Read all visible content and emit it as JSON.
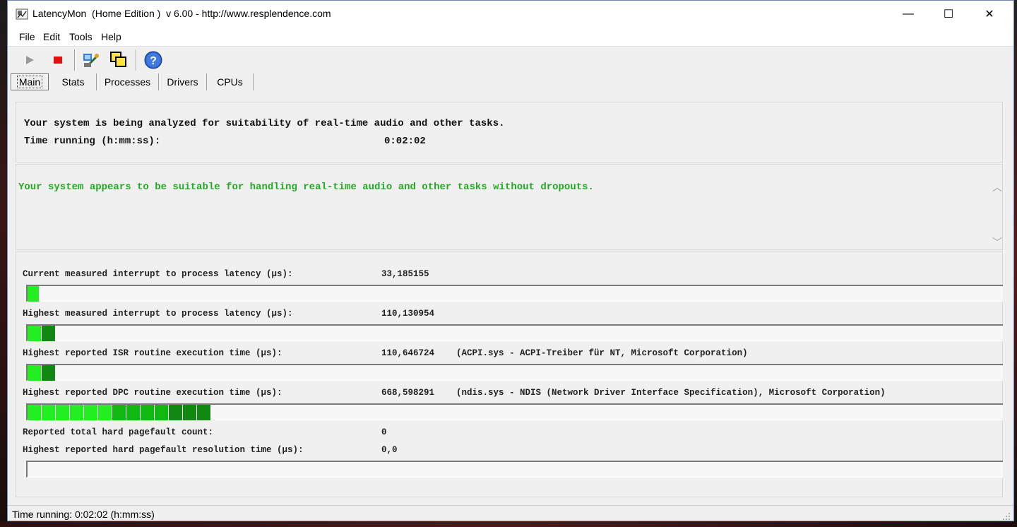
{
  "window": {
    "title": "LatencyMon  (Home Edition )  v 6.00 - http://www.resplendence.com",
    "minimize_glyph": "—",
    "maximize_glyph": "☐",
    "close_glyph": "✕"
  },
  "menu": {
    "items": [
      {
        "label": "File"
      },
      {
        "label": "Edit"
      },
      {
        "label": "Tools"
      },
      {
        "label": "Help"
      }
    ]
  },
  "toolbar": {
    "buttons": [
      {
        "icon": "play-icon"
      },
      {
        "icon": "stop-icon"
      },
      {
        "icon": "settings-wizard-icon"
      },
      {
        "icon": "windows-overlap-icon"
      },
      {
        "icon": "help-icon"
      }
    ]
  },
  "tabs": [
    {
      "label": "Main",
      "active": true
    },
    {
      "label": "Stats"
    },
    {
      "label": "Processes"
    },
    {
      "label": "Drivers"
    },
    {
      "label": "CPUs"
    }
  ],
  "main": {
    "analysis_line": "Your system is being analyzed for suitability of real-time audio and other tasks.",
    "time_running_label": "Time running (h:mm:ss):",
    "time_running_value": "0:02:02",
    "verdict": "Your system appears to be suitable for handling real-time audio and other tasks without dropouts.",
    "verdict_color": "#22aa22"
  },
  "metrics": [
    {
      "label": "Current measured interrupt to process latency (µs):",
      "value": "33,185155",
      "detail": "",
      "bar_fraction": 0.012
    },
    {
      "label": "Highest measured interrupt to process latency (µs):",
      "value": "110,130954",
      "detail": "",
      "bar_fraction": 0.027
    },
    {
      "label": "Highest reported ISR routine execution time (µs):",
      "value": "110,646724",
      "detail": "(ACPI.sys - ACPI-Treiber für NT, Microsoft Corporation)",
      "bar_fraction": 0.027
    },
    {
      "label": "Highest reported DPC routine execution time (µs):",
      "value": "668,598291",
      "detail": "(ndis.sys - NDIS (Network Driver Interface Specification), Microsoft Corporation)",
      "bar_fraction": 0.185
    }
  ],
  "pagefault": {
    "count_label": "Reported total hard pagefault count:",
    "count_value": "0",
    "time_label": "Highest reported hard pagefault resolution time (µs):",
    "time_value": "0,0",
    "bar_fraction": 0
  },
  "status": {
    "text": "Time running: 0:02:02  (h:mm:ss)"
  },
  "colors": {
    "bar_bright": "#22ee22",
    "bar_mid": "#11b811",
    "bar_dark": "#118811"
  }
}
